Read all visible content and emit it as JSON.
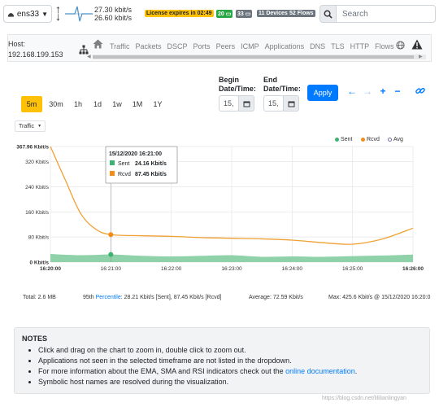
{
  "topbar": {
    "interface": "ens33",
    "rate_up": "27.30 kbit/s",
    "rate_down": "26.60 kbit/s",
    "license": "License expires in 02:49",
    "badge_hosts_green": "20",
    "badge_hosts_gray": "33",
    "badge_devices": "11 Devices",
    "badge_flows": "52 Flows",
    "search_placeholder": "Search"
  },
  "host": {
    "label": "Host:",
    "ip": "192.168.199.153",
    "tabs": [
      "Traffic",
      "Packets",
      "DSCP",
      "Ports",
      "Peers",
      "ICMP",
      "Applications",
      "DNS",
      "TLS",
      "HTTP",
      "Flows"
    ]
  },
  "controls": {
    "begin_label": "Begin",
    "begin_label2": "Date/Time:",
    "end_label": "End",
    "end_label2": "Date/Time:",
    "begin_value": "15,",
    "end_value": "15,",
    "apply": "Apply",
    "timeframes": [
      "5m",
      "30m",
      "1h",
      "1d",
      "1w",
      "1M",
      "1Y"
    ],
    "active_timeframe": "5m",
    "metric": "Traffic"
  },
  "legend": {
    "sent": "Sent",
    "rcvd": "Rcvd",
    "avg": "Avg"
  },
  "tooltip": {
    "time": "15/12/2020 16:21:00",
    "sent_label": "Sent",
    "sent_value": "24.16 Kbit/s",
    "rcvd_label": "Rcvd",
    "rcvd_value": "87.45 Kbit/s"
  },
  "chart_data": {
    "type": "area",
    "y_axis_labels": [
      "367.96 Kbit/s",
      "320 Kbit/s",
      "240 Kbit/s",
      "160 Kbit/s",
      "80 Kbit/s",
      "0 Kbit/s"
    ],
    "y_ticks": [
      367.96,
      320,
      240,
      160,
      80,
      0
    ],
    "ylim": [
      0,
      367.96
    ],
    "x_labels": [
      "16:20:00",
      "16:21:00",
      "16:22:00",
      "16:23:00",
      "16:24:00",
      "16:25:00",
      "16:26:00"
    ],
    "x_label_minutes": [
      0,
      1,
      2,
      3,
      4,
      5,
      6
    ],
    "xlim_minutes": [
      0,
      6
    ],
    "grid": true,
    "legend_position": "top-right",
    "colors": {
      "sent": "#7cc99a",
      "rcvd": "#f0a033"
    },
    "series": [
      {
        "name": "Rcvd",
        "type": "line",
        "x_minutes": [
          0,
          0.25,
          0.5,
          0.75,
          1.0,
          1.5,
          2.0,
          2.5,
          3.0,
          3.5,
          4.0,
          4.5,
          5.0,
          5.5,
          6.0
        ],
        "values": [
          367.96,
          260,
          155,
          105,
          87.45,
          84,
          82,
          78,
          76,
          74,
          70,
          62,
          57,
          74,
          108
        ]
      },
      {
        "name": "Sent",
        "type": "area",
        "x_minutes": [
          0,
          0.5,
          1.0,
          1.5,
          2.0,
          2.5,
          3.0,
          3.5,
          4.0,
          4.5,
          5.0,
          5.5,
          6.0
        ],
        "values": [
          26,
          22,
          24.16,
          20,
          18,
          20,
          22,
          17,
          18,
          17,
          19,
          21,
          24
        ]
      }
    ]
  },
  "stats": {
    "total": "Total: 2.6 MB",
    "percentile_prefix": "95th",
    "percentile_link": "Percentile",
    "percentile_value": ": 28.21 Kbit/s [Sent], 87.45 Kbit/s [Rcvd]",
    "average": "Average: 72.59 Kbit/s",
    "max": "Max: 425.6 Kbit/s @ 15/12/2020 16:20:0"
  },
  "notes": {
    "title": "NOTES",
    "item1": "Click and drag on the chart to zoom in, double click to zoom out.",
    "item2": "Applications not seen in the selected timeframe are not listed in the dropdown.",
    "item3_prefix": "For more information about the EMA, SMA and RSI indicators check out the ",
    "item3_link": "online documentation",
    "item3_suffix": ".",
    "item4": "Symbolic host names are resolved during the visualization."
  },
  "watermark": "https://blog.csdn.net/lililianlingyan"
}
